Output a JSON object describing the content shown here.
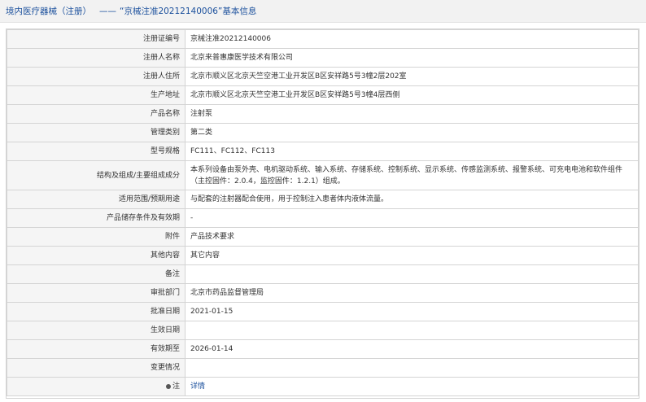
{
  "header": {
    "title_left": "境内医疗器械（注册）",
    "separator": "——",
    "title_right": "“京械注准20212140006”基本信息"
  },
  "rows": [
    {
      "key": "注册证编号",
      "value": "京械注准20212140006"
    },
    {
      "key": "注册人名称",
      "value": "北京来普惠康医学技术有限公司"
    },
    {
      "key": "注册人住所",
      "value": "北京市顺义区北京天竺空港工业开发区B区安祥路5号3幢2层202室"
    },
    {
      "key": "生产地址",
      "value": "北京市顺义区北京天竺空港工业开发区B区安祥路5号3幢4层西侧"
    },
    {
      "key": "产品名称",
      "value": "注射泵"
    },
    {
      "key": "管理类别",
      "value": "第二类"
    },
    {
      "key": "型号规格",
      "value": "FC111、FC112、FC113"
    },
    {
      "key": "结构及组成/主要组成成分",
      "value": "本系列设备由泵外壳、电机驱动系统、输入系统、存储系统、控制系统、显示系统、传感监测系统、报警系统、可充电电池和软件组件（主控固件：2.0.4，监控固件：1.2.1）组成。"
    },
    {
      "key": "适用范围/预期用途",
      "value": "与配套的注射器配合使用，用于控制注入患者体内液体流量。"
    },
    {
      "key": "产品储存条件及有效期",
      "value": "-"
    },
    {
      "key": "附件",
      "value": "产品技术要求"
    },
    {
      "key": "其他内容",
      "value": "其它内容"
    },
    {
      "key": "备注",
      "value": ""
    },
    {
      "key": "审批部门",
      "value": "北京市药品监督管理局"
    },
    {
      "key": "批准日期",
      "value": "2021-01-15"
    },
    {
      "key": "生效日期",
      "value": ""
    },
    {
      "key": "有效期至",
      "value": "2026-01-14"
    },
    {
      "key": "变更情况",
      "value": ""
    }
  ],
  "note_row": {
    "key": "注",
    "link": "详情"
  }
}
